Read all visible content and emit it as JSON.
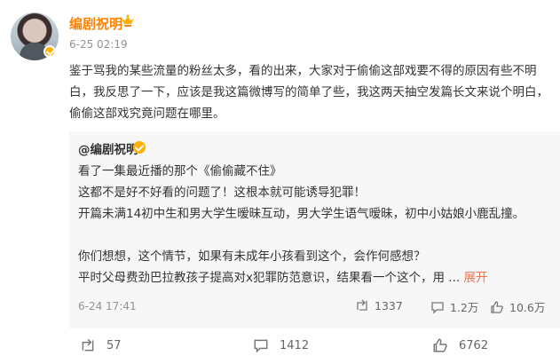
{
  "author": {
    "name": "编剧祝明",
    "meta": "6-25 02:19"
  },
  "post": {
    "text": "鉴于骂我的某些流量的粉丝太多，看的出来，大家对于偷偷这部戏要不得的原因有些不明白，我反思了一下，应该是我这篇微博写的简单了些，我这两天抽空发篇长文来说个明白，偷偷这部戏究竟问题在哪里。"
  },
  "quote": {
    "name": "@编剧祝明",
    "lines": [
      "看了一集最近播的那个《偷偷藏不住》",
      "这都不是好不好看的问题了！这根本就可能诱导犯罪！",
      "开篇未满14初中生和男大学生暧昧互动，男大学生语气暧昧，初中小姑娘小鹿乱撞。",
      "",
      "你们想想，这个情节，如果有未成年小孩看到这个，会作何感想？",
      "平时父母费劲巴拉教孩子提高对x犯罪防范意识，结果看一个这个，用 ..."
    ],
    "expand": "展开",
    "date": "6-24 17:41",
    "stats": {
      "repost": "1337",
      "comment": "1.2万",
      "like": "10.6万"
    }
  },
  "footer": {
    "repost": "57",
    "comment": "1412",
    "like": "6762"
  },
  "colors": {
    "name": "#ff8200",
    "expand": "#eb7350",
    "quote_bg": "#f7f7f7",
    "muted": "#939393"
  }
}
